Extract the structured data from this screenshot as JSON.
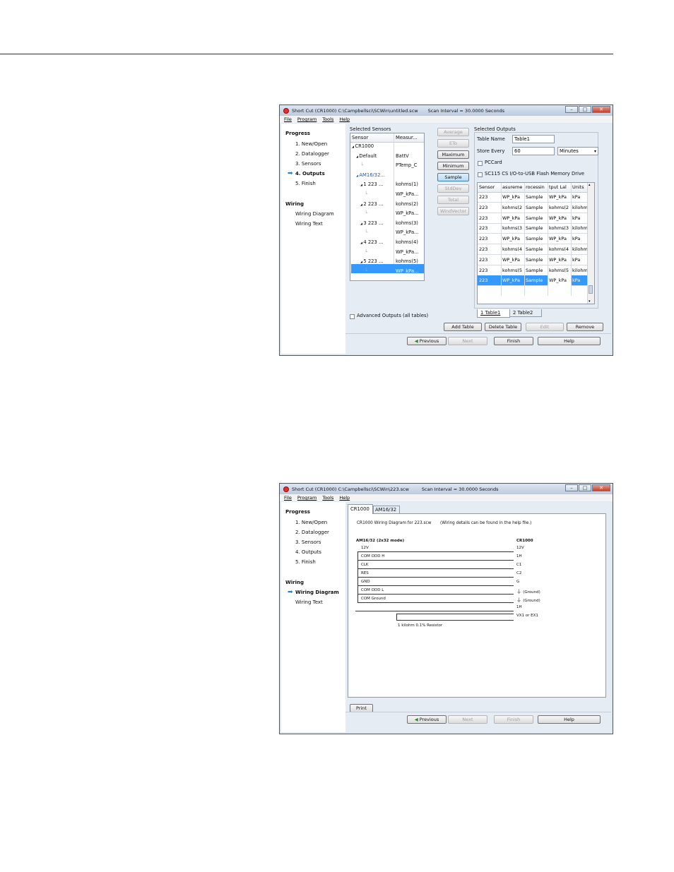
{
  "window1": {
    "title": "Short Cut (CR1000) C:\\Campbellsci\\SCWin\\untitled.scw",
    "scan": "Scan Interval = 30.0000 Seconds",
    "menu": [
      "File",
      "Program",
      "Tools",
      "Help"
    ],
    "nav": {
      "progress": "Progress",
      "steps": [
        "1. New/Open",
        "2. Datalogger",
        "3. Sensors",
        "4. Outputs",
        "5. Finish"
      ],
      "wiring": "Wiring",
      "wiring_items": [
        "Wiring Diagram",
        "Wiring Text"
      ]
    },
    "selected_sensors": {
      "label": "Selected Sensors",
      "columns": [
        "Sensor",
        "Measur..."
      ],
      "rows": [
        {
          "name": "CR1000",
          "meas": ""
        },
        {
          "name": "Default",
          "meas": "BattV"
        },
        {
          "name": "",
          "meas": "PTemp_C"
        },
        {
          "name": "AM16/32...",
          "meas": ""
        },
        {
          "name": "1 223 ...",
          "meas": "kohms(1)"
        },
        {
          "name": "",
          "meas": "WP_kPa..."
        },
        {
          "name": "2 223 ...",
          "meas": "kohms(2)"
        },
        {
          "name": "",
          "meas": "WP_kPa..."
        },
        {
          "name": "3 223 ...",
          "meas": "kohms(3)"
        },
        {
          "name": "",
          "meas": "WP_kPa..."
        },
        {
          "name": "4 223 ...",
          "meas": "kohms(4)"
        },
        {
          "name": "",
          "meas": "WP_kPa..."
        },
        {
          "name": "5 223 ...",
          "meas": "kohms(5)"
        },
        {
          "name": "",
          "meas": "WP_kPa..."
        }
      ]
    },
    "output_buttons": [
      "Average",
      "ETo",
      "Maximum",
      "Minimum",
      "Sample",
      "StdDev",
      "Total",
      "WindVector"
    ],
    "selected_outputs": {
      "label": "Selected Outputs",
      "table_name_label": "Table Name",
      "table_name": "Table1",
      "store_every_label": "Store Every",
      "store_every": "60",
      "interval_unit": "Minutes",
      "pccard": "PCCard",
      "sc115": "SC115 CS I/O-to-USB Flash Memory Drive",
      "columns": [
        "Sensor",
        "asureme",
        "rocessin",
        "tput Lal",
        "Units"
      ],
      "rows": [
        [
          "223",
          "WP_kPa",
          "Sample",
          "WP_kPa",
          "kPa"
        ],
        [
          "223",
          "kohms(2",
          "Sample",
          "kohms(2",
          "kilohm"
        ],
        [
          "223",
          "WP_kPa",
          "Sample",
          "WP_kPa",
          "kPa"
        ],
        [
          "223",
          "kohms(3",
          "Sample",
          "kohms(3",
          "kilohm"
        ],
        [
          "223",
          "WP_kPa",
          "Sample",
          "WP_kPa",
          "kPa"
        ],
        [
          "223",
          "kohms(4",
          "Sample",
          "kohms(4",
          "kilohm"
        ],
        [
          "223",
          "WP_kPa",
          "Sample",
          "WP_kPa",
          "kPa"
        ],
        [
          "223",
          "kohms(5",
          "Sample",
          "kohms(5",
          "kilohm"
        ],
        [
          "223",
          "WP_kPa",
          "Sample",
          "WP_kPa",
          "kPa"
        ]
      ],
      "tabs": [
        "1 Table1",
        "2 Table2"
      ]
    },
    "advanced": "Advanced Outputs (all tables)",
    "table_buttons": [
      "Add Table",
      "Delete Table",
      "Edit",
      "Remove"
    ],
    "footer": [
      "Previous",
      "Next",
      "Finish",
      "Help"
    ]
  },
  "window2": {
    "title": "Short Cut (CR1000) C:\\Campbellsci\\SCWin\\223.scw",
    "scan": "Scan Interval = 30.0000 Seconds",
    "menu": [
      "File",
      "Program",
      "Tools",
      "Help"
    ],
    "nav": {
      "progress": "Progress",
      "steps": [
        "1. New/Open",
        "2. Datalogger",
        "3. Sensors",
        "4. Outputs",
        "5. Finish"
      ],
      "wiring": "Wiring",
      "wiring_items": [
        "Wiring Diagram",
        "Wiring Text"
      ]
    },
    "tabs": [
      "CR1000",
      "AM16/32"
    ],
    "diagram": {
      "heading": "CR1000 Wiring Diagram for 223.scw",
      "note": "(Wiring details can be found in the help file.)",
      "left_title": "AM16/32 (2x32 mode)",
      "right_title": "CR1000",
      "left_labels": [
        "12V",
        "COM ODD H",
        "CLK",
        "RES",
        "GND",
        "COM ODD L",
        "COM Ground"
      ],
      "right_labels": [
        "12V",
        "1H",
        "C1",
        "C2",
        "G",
        "(Ground)",
        "(Ground)",
        "1H",
        "VX1 or EX1"
      ],
      "resistor": "1 kilohm 0.1% Resistor"
    },
    "print": "Print",
    "footer": [
      "Previous",
      "Next",
      "Finish",
      "Help"
    ]
  }
}
